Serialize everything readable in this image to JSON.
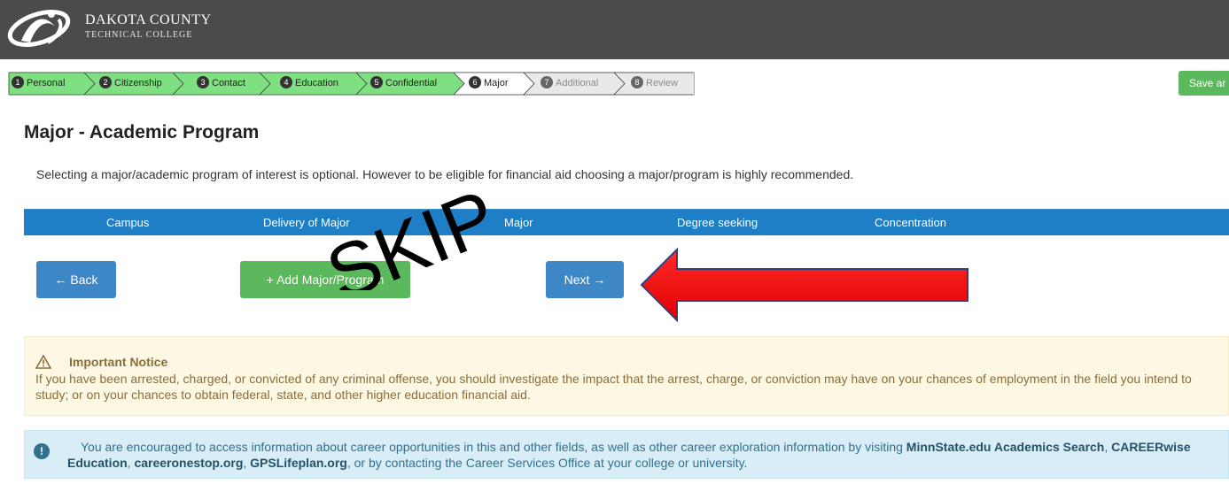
{
  "header": {
    "brand_line1": "DAKOTA COUNTY",
    "brand_line2": "TECHNICAL COLLEGE"
  },
  "steps": [
    {
      "num": "1",
      "label": "Personal",
      "state": "complete"
    },
    {
      "num": "2",
      "label": "Citizenship",
      "state": "complete"
    },
    {
      "num": "3",
      "label": "Contact",
      "state": "complete"
    },
    {
      "num": "4",
      "label": "Education",
      "state": "complete"
    },
    {
      "num": "5",
      "label": "Confidential",
      "state": "complete"
    },
    {
      "num": "6",
      "label": "Major",
      "state": "current"
    },
    {
      "num": "7",
      "label": "Additional",
      "state": "disabled"
    },
    {
      "num": "8",
      "label": "Review",
      "state": "disabled"
    }
  ],
  "save_button": "Save ar",
  "page": {
    "title": "Major - Academic Program",
    "intro": "Selecting a major/academic program of interest is optional. However to be eligible for financial aid choosing a major/program is highly recommended."
  },
  "table": {
    "columns": [
      "Campus",
      "Delivery of Major",
      "Major",
      "Degree seeking",
      "Concentration"
    ]
  },
  "buttons": {
    "back": "← Back",
    "add": "+ Add Major/Program",
    "next": "Next →"
  },
  "annotation": {
    "skip_text": "SKIP"
  },
  "notice": {
    "title": "Important Notice",
    "body": "If you have been arrested, charged, or convicted of any criminal offense, you should investigate the impact that the arrest, charge, or conviction may have on your chances of employment in the field you intend to study; or on your chances to obtain federal, state, and other higher education financial aid."
  },
  "info": {
    "text_before": "You are encouraged to access information about career opportunities in this and other fields, as well as other career exploration information by visiting ",
    "link1": "MinnState.edu Academics Search",
    "sep1": ", ",
    "link2": "CAREERwise Education",
    "sep2": ", ",
    "link3": "careeronestop.org",
    "sep3": ", ",
    "link4": "GPSLifeplan.org",
    "text_after": ", or by contacting the Career Services Office at your college or university."
  },
  "colors": {
    "header_bg": "#4b4b4b",
    "step_complete": "#7ee081",
    "step_current": "#ffffff",
    "step_disabled": "#e9e9e9",
    "primary": "#3e87c6",
    "success": "#5cb85c",
    "table_head": "#1e7ec6",
    "arrow_red": "#ff0000"
  }
}
